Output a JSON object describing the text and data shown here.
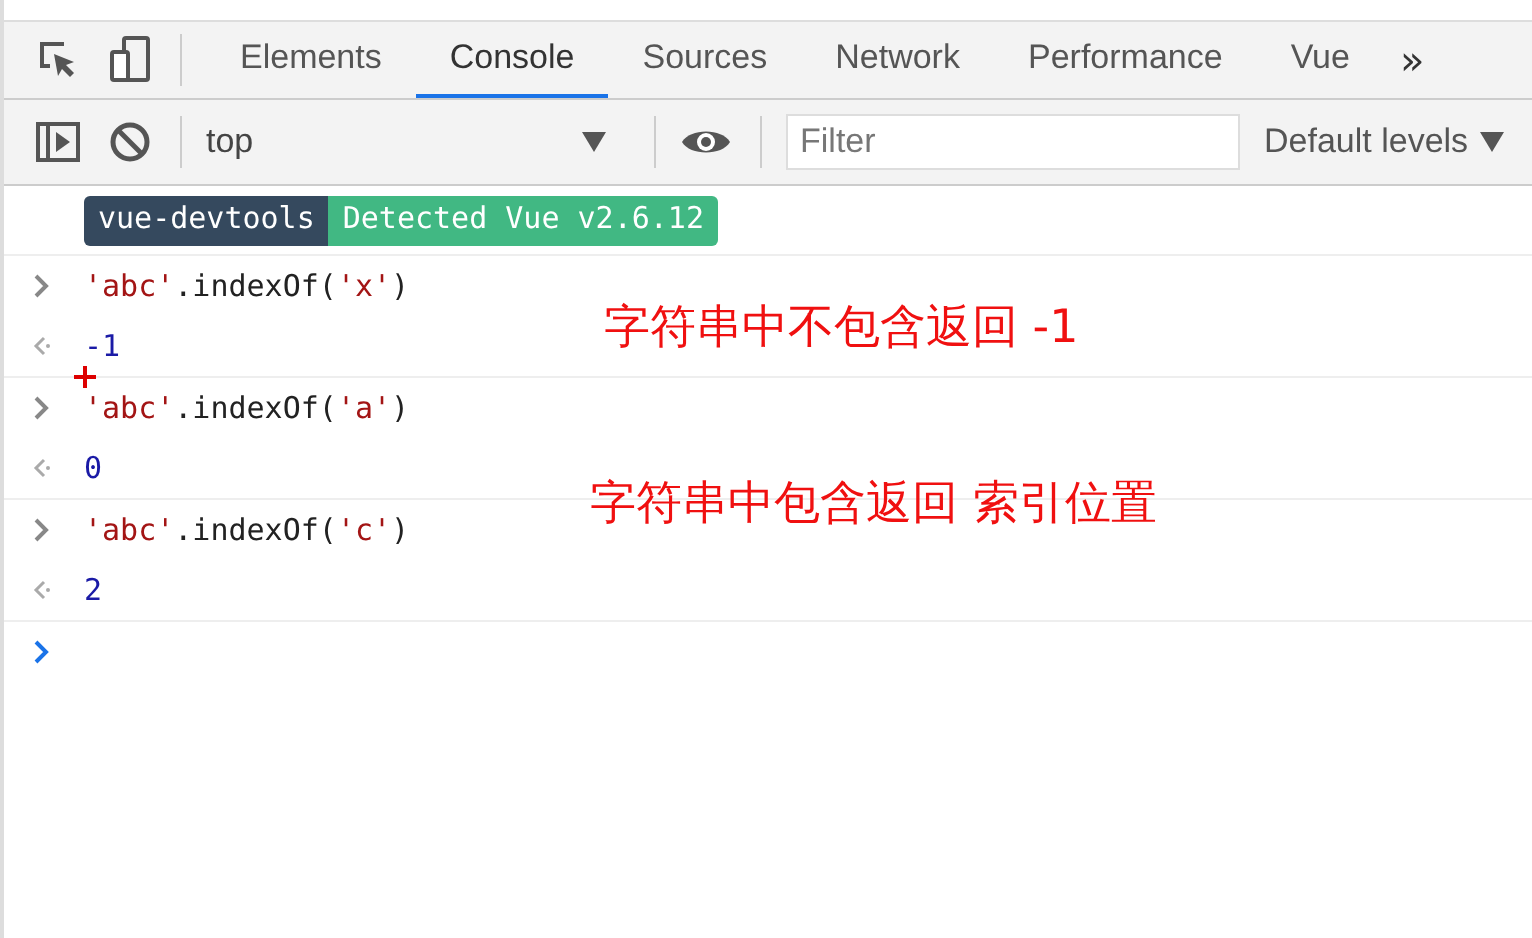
{
  "tabs": [
    {
      "label": "Elements",
      "selected": false
    },
    {
      "label": "Console",
      "selected": true
    },
    {
      "label": "Sources",
      "selected": false
    },
    {
      "label": "Network",
      "selected": false
    },
    {
      "label": "Performance",
      "selected": false
    },
    {
      "label": "Vue",
      "selected": false
    }
  ],
  "more_tabs": "»",
  "toolbar": {
    "context": "top",
    "filter": {
      "placeholder": "Filter"
    },
    "levels": "Default levels"
  },
  "badge": {
    "name": "vue-devtools",
    "message": "Detected Vue v2.6.12"
  },
  "entries": [
    {
      "kind": "input",
      "tokens": [
        {
          "kind": "string",
          "text": "'abc'"
        },
        {
          "kind": "plain",
          "text": ".indexOf("
        },
        {
          "kind": "string",
          "text": "'x'"
        },
        {
          "kind": "plain",
          "text": ")"
        }
      ]
    },
    {
      "kind": "output",
      "value": "-1"
    },
    {
      "kind": "input",
      "tokens": [
        {
          "kind": "string",
          "text": "'abc'"
        },
        {
          "kind": "plain",
          "text": ".indexOf("
        },
        {
          "kind": "string",
          "text": "'a'"
        },
        {
          "kind": "plain",
          "text": ")"
        }
      ]
    },
    {
      "kind": "output",
      "value": "0"
    },
    {
      "kind": "input",
      "tokens": [
        {
          "kind": "string",
          "text": "'abc'"
        },
        {
          "kind": "plain",
          "text": ".indexOf("
        },
        {
          "kind": "string",
          "text": "'c'"
        },
        {
          "kind": "plain",
          "text": ")"
        }
      ]
    },
    {
      "kind": "output",
      "value": "2"
    },
    {
      "kind": "prompt"
    }
  ],
  "annotations": [
    "字符串中不包含返回 -1",
    "字符串中包含返回 索引位置"
  ]
}
